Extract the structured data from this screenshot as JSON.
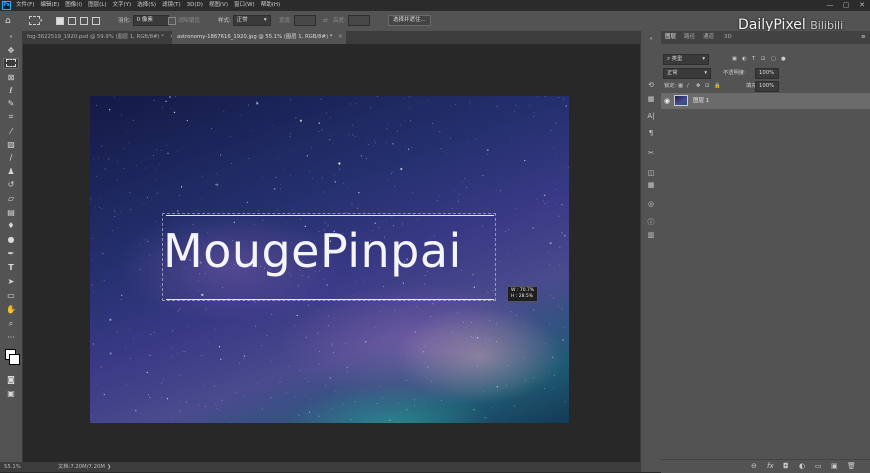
{
  "menubar": {
    "app_icon": "Ps",
    "items": [
      "文件(F)",
      "编辑(E)",
      "图像(I)",
      "图层(L)",
      "文字(Y)",
      "选择(S)",
      "滤镜(T)",
      "3D(D)",
      "视图(V)",
      "窗口(W)",
      "帮助(H)"
    ],
    "window_controls": [
      "—",
      "▢",
      "✕"
    ]
  },
  "options": {
    "feather_label": "羽化:",
    "feather_value": "0 像素",
    "antialias_label": "消除锯齿",
    "style_label": "样式:",
    "style_value": "正常",
    "width_label": "宽度:",
    "height_label": "高度:",
    "select_mask_button": "选择并遮住..."
  },
  "tabs": [
    {
      "label": "fog-3622519_1920.psd @ 59.9% (图层 1, RGB/8#) *",
      "active": false
    },
    {
      "label": "astronomy-1867616_1920.jpg @ 55.1% (图层 1, RGB/8#) *",
      "active": true
    }
  ],
  "canvas": {
    "text": "MougePinpai",
    "transform_w": "W : 70.7%",
    "transform_h": "H : 28.5%"
  },
  "status": {
    "zoom": "55.1%",
    "doc": "文档:7.20M/7.20M"
  },
  "panel": {
    "tabs": [
      "图层",
      "路径",
      "通道",
      "3D"
    ],
    "filter_label": "类型",
    "blend_mode": "正常",
    "opacity_label": "不透明度:",
    "opacity_value": "100%",
    "lock_label": "锁定:",
    "fill_label": "填充:",
    "fill_value": "100%",
    "layer_name": "图层 1",
    "bottom_icons": [
      "⊖",
      "fx",
      "◘",
      "◐",
      "▭",
      "▣",
      "🗑"
    ]
  },
  "watermark": {
    "text": "DailyPixel",
    "bili": "Bilibili"
  }
}
